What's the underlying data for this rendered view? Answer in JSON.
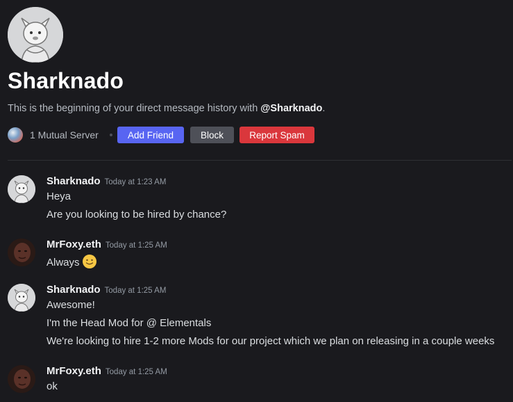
{
  "profile": {
    "name": "Sharknado",
    "intro_text": "This is the beginning of your direct message history with ",
    "intro_handle": "@Sharknado",
    "intro_end": ".",
    "mutual_servers": "1 Mutual Server"
  },
  "actions": {
    "add_friend": "Add Friend",
    "block": "Block",
    "report_spam": "Report Spam"
  },
  "messages": [
    {
      "author": "Sharknado",
      "time": "Today at 1:23 AM",
      "lines": [
        "Heya",
        "Are you looking to be hired by chance?"
      ]
    },
    {
      "author": "MrFoxy.eth",
      "time": "Today at 1:25 AM",
      "lines": [
        "Always"
      ],
      "emoji": "slightly-smiling-face-emoji"
    },
    {
      "author": "Sharknado",
      "time": "Today at 1:25 AM",
      "lines": [
        "Awesome!",
        "I'm the Head Mod for @ Elementals",
        "We're looking to hire 1-2 more Mods for our project which we plan on releasing in a couple weeks"
      ]
    },
    {
      "author": "MrFoxy.eth",
      "time": "Today at 1:25 AM",
      "lines": [
        "ok"
      ]
    }
  ],
  "colors": {
    "background": "#1a1a1e",
    "add_friend": "#5865f2",
    "block": "#4e5058",
    "report_spam": "#da373c"
  }
}
